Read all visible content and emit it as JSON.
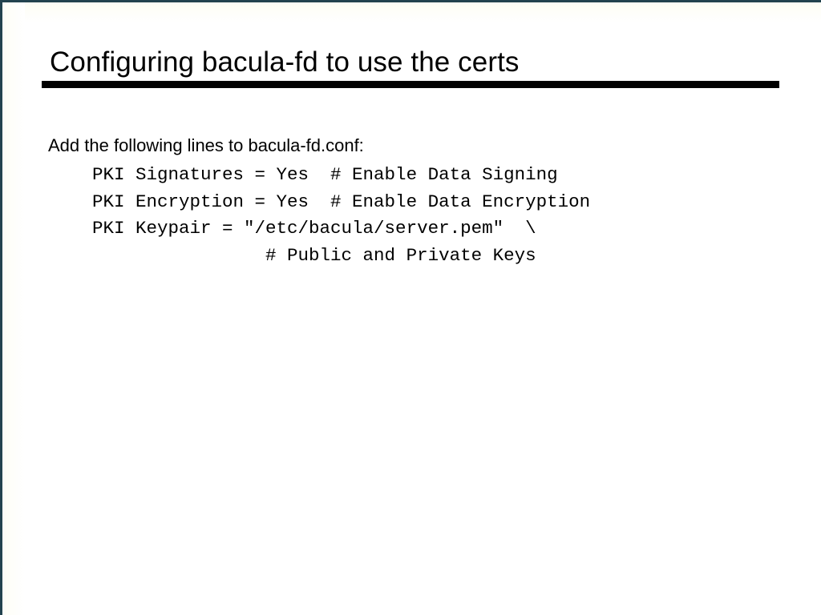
{
  "slide": {
    "title": "Configuring bacula-fd to use the certs",
    "lead": "Add the following lines to bacula-fd.conf:",
    "code_lines": [
      "PKI Signatures = Yes  # Enable Data Signing",
      "PKI Encryption = Yes  # Enable Data Encryption",
      "PKI Keypair = \"/etc/bacula/server.pem\"  \\",
      "                # Public and Private Keys"
    ],
    "colors": {
      "background": "#ffffff",
      "text": "#000000",
      "edge_rule": "#23434f",
      "title_rule": "#000000"
    }
  }
}
